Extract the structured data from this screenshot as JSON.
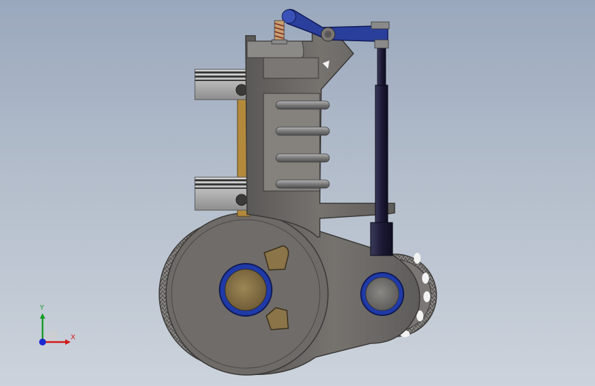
{
  "viewport": {
    "background_top": "#9aa8bd",
    "background_bottom": "#ccd3dc"
  },
  "model": {
    "body_color": "#6e6b68",
    "dark_gray": "#4c4a48",
    "bearing_color": "#8a7448",
    "bearing_ring_color": "#1f3aa8",
    "rocker_color": "#2a3f9c",
    "pushrod_color": "#1c1a35",
    "fin_color": "#8c8c8c",
    "crank_brown": "#b38a3c"
  },
  "triad": {
    "x_label": "X",
    "y_label": "Y",
    "x_color": "#d21a1a",
    "y_color": "#1a9a2a",
    "z_color": "#1a2ad2"
  }
}
